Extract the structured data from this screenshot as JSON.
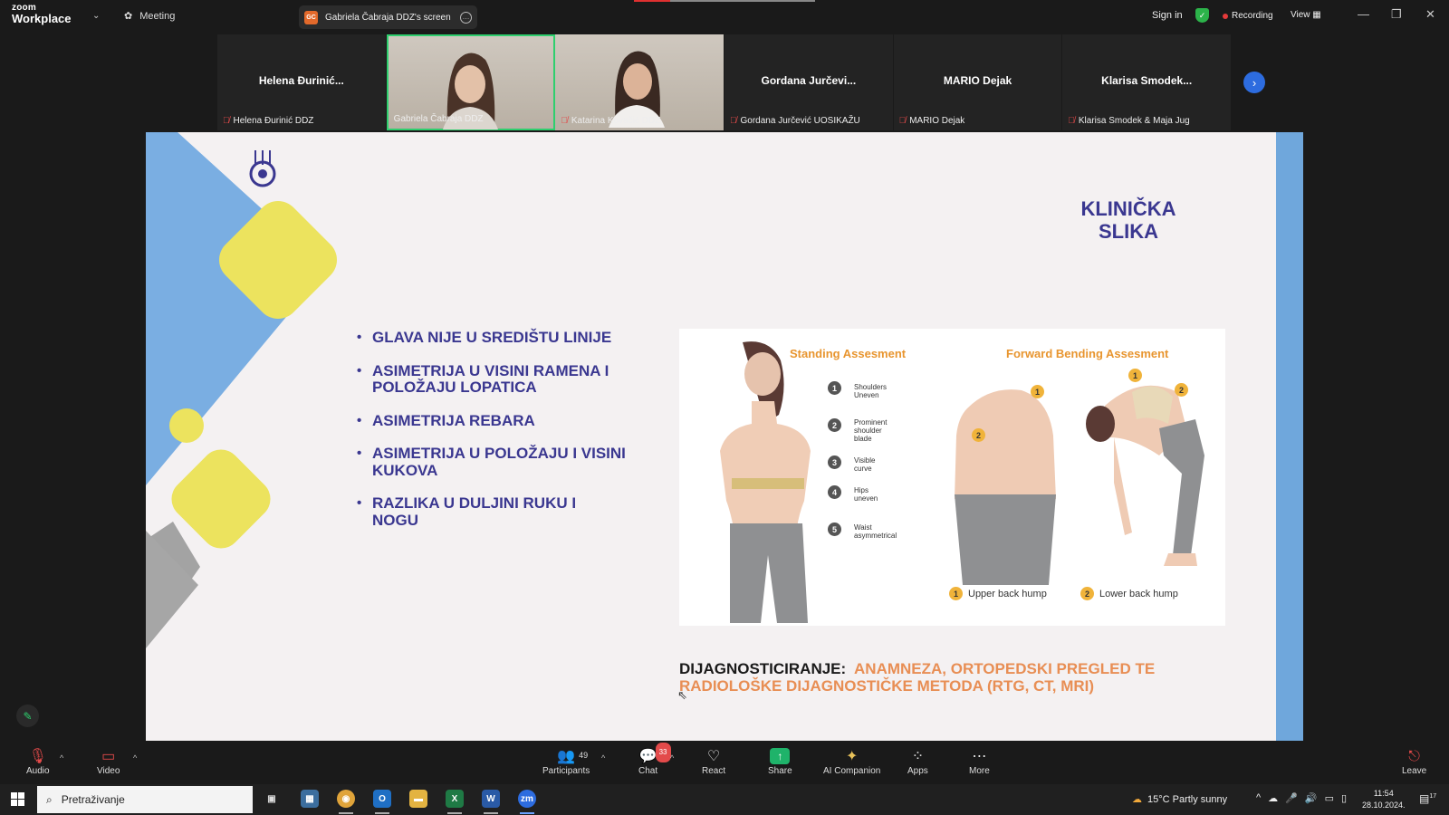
{
  "app": {
    "logo_line1": "zoom",
    "logo_line2": "Workplace",
    "meeting_label": "Meeting",
    "share_gc": "GC",
    "share_label": "Gabriela Čabraja DDZ's screen",
    "sign_in": "Sign in",
    "recording": "Recording",
    "view": "View"
  },
  "participants": [
    {
      "display": "Helena  Đurinić...",
      "label": "Helena Đurinić DDZ",
      "video": false,
      "muted": true
    },
    {
      "display": "",
      "label": "Gabriela Čabraja DDZ",
      "video": true,
      "active": true,
      "muted": false
    },
    {
      "display": "",
      "label": "Katarina Kovačić DDZ",
      "video": true,
      "muted": true
    },
    {
      "display": "Gordana  Jurčevi...",
      "label": "Gordana Jurčević UOSIKAŽU",
      "video": false,
      "muted": true
    },
    {
      "display": "MARIO Dejak",
      "label": "MARIO Dejak",
      "video": false,
      "muted": true
    },
    {
      "display": "Klarisa  Smodek...",
      "label": "Klarisa Smodek & Maja Jug",
      "video": false,
      "muted": true
    }
  ],
  "slide": {
    "title_line1": "KLINIČKA",
    "title_line2": "SLIKA",
    "bullets": [
      "GLAVA NIJE U SREDIŠTU LINIJE",
      "ASIMETRIJA U VISINI RAMENA I POLOŽAJU LOPATICA",
      "ASIMETRIJA REBARA",
      "ASIMETRIJA U POLOŽAJU I VISINI KUKOVA",
      "RAZLIKA U DULJINI RUKU I NOGU"
    ],
    "diagram": {
      "standing_title": "Standing Assesment",
      "forward_title": "Forward Bending Assesment",
      "steps": [
        {
          "n": "1",
          "text": "Shoulders Uneven"
        },
        {
          "n": "2",
          "text": "Prominent shoulder blade"
        },
        {
          "n": "3",
          "text": "Visible curve"
        },
        {
          "n": "4",
          "text": "Hips uneven"
        },
        {
          "n": "5",
          "text": "Waist asymmetrical"
        }
      ],
      "markers": [
        "1",
        "2",
        "1",
        "2"
      ],
      "legend": [
        {
          "n": "1",
          "text": "Upper back hump"
        },
        {
          "n": "2",
          "text": "Lower back hump"
        }
      ]
    },
    "diag_label": "DIJAGNOSTICIRANJE:",
    "diag_value": "ANAMNEZA, ORTOPEDSKI PREGLED TE RADIOLOŠKE DIJAGNOSTIČKE METODA (RTG, CT, MRI)"
  },
  "toolbar": {
    "audio": "Audio",
    "video": "Video",
    "participants": "Participants",
    "participants_count": "49",
    "chat": "Chat",
    "chat_badge": "33",
    "react": "React",
    "share": "Share",
    "ai": "AI Companion",
    "apps": "Apps",
    "more": "More",
    "leave": "Leave"
  },
  "taskbar": {
    "search": "Pretraživanje",
    "weather": "15°C  Partly sunny",
    "time": "11:54",
    "date": "28.10.2024.",
    "notif_count": "17"
  },
  "colors": {
    "accent_green": "#2ecf6e",
    "slide_title": "#3a3790",
    "diag_orange": "#e88e54",
    "share_green": "#1fb36a"
  }
}
